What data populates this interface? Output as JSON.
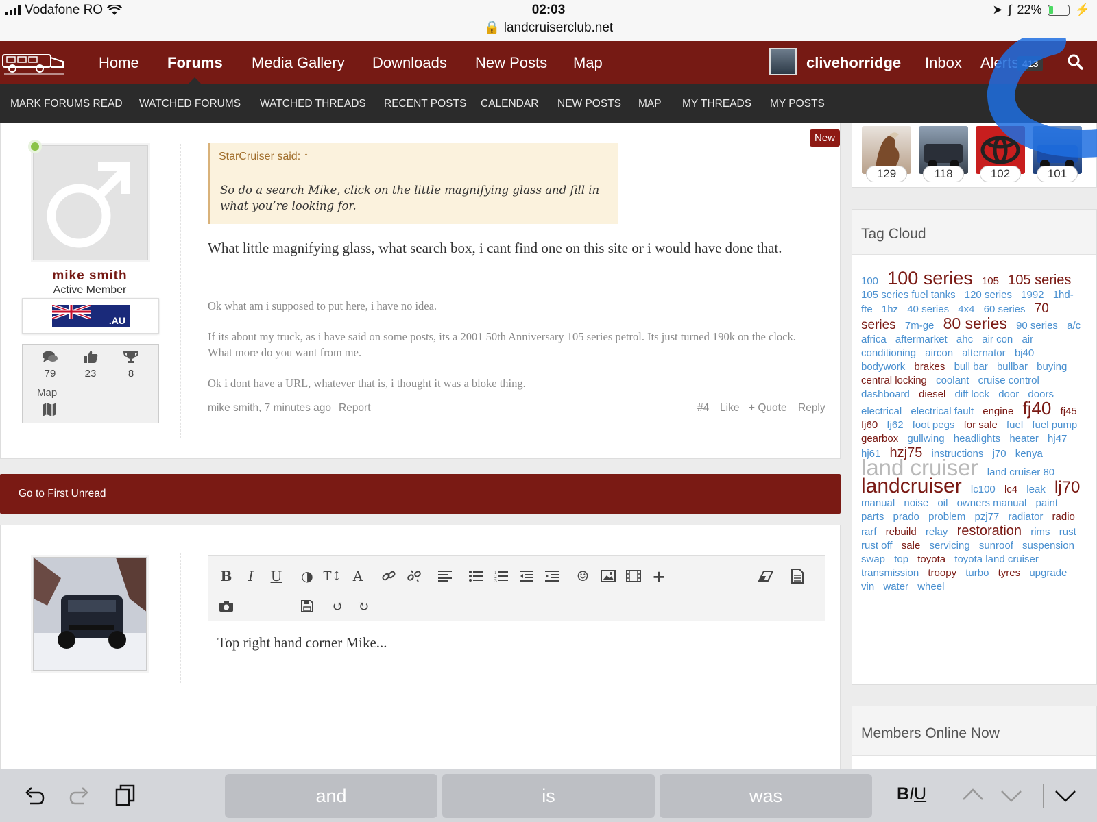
{
  "status_bar": {
    "carrier": "Vodafone RO",
    "time": "02:03",
    "url": "landcruiserclub.net",
    "battery": "22%",
    "battery_level": 0.22
  },
  "top_nav": {
    "items": [
      "Home",
      "Forums",
      "Media Gallery",
      "Downloads",
      "New Posts",
      "Map"
    ],
    "active": "Forums",
    "username": "clivehorridge",
    "inbox": "Inbox",
    "alerts": "Alerts",
    "alerts_count": "413"
  },
  "sub_nav": {
    "items": [
      "MARK FORUMS READ",
      "WATCHED FORUMS",
      "WATCHED THREADS",
      "RECENT POSTS",
      "CALENDAR",
      "NEW POSTS",
      "MAP",
      "MY THREADS",
      "MY POSTS"
    ]
  },
  "post": {
    "author": "mike smith",
    "user_title": "Active Member",
    "flag_text": ".AU",
    "stats": {
      "messages": "79",
      "likes": "23",
      "trophies": "8"
    },
    "map_label": "Map",
    "new_badge": "New",
    "quote_author": "StarCruiser said: ↑",
    "quote_text": "So do a search Mike, click on the little magnifying glass and fill in what you’re looking for.",
    "body": "What little magnifying glass, what search box, i cant find one on this site or i would have done that.",
    "signature": [
      "Ok what am i supposed to put here, i have no idea.",
      "If its about my truck, as i have said on some posts, its a 2001 50th Anniversary 105 series petrol. Its just turned 190k on the clock. What more do you want from me.",
      "Ok i dont have a URL, whatever that is, i thought it was a bloke thing."
    ],
    "meta_author_time": "mike smith, 7 minutes ago",
    "report": "Report",
    "post_number": "#4",
    "like": "Like",
    "quote": "+ Quote",
    "reply": "Reply"
  },
  "unread_bar": {
    "label": "Go to First Unread"
  },
  "reply_editor": {
    "text": "Top right hand corner Mike..."
  },
  "sidebar": {
    "thumb_counts": [
      "129",
      "118",
      "102",
      "101"
    ],
    "tag_cloud_title": "Tag Cloud",
    "tags": [
      {
        "t": "100",
        "s": 15,
        "c": "b"
      },
      {
        "t": "100 series",
        "s": 27,
        "c": "d"
      },
      {
        "t": "105",
        "s": 15,
        "c": "d"
      },
      {
        "t": "105 series",
        "s": 20,
        "c": "d"
      },
      {
        "t": "105 series fuel tanks",
        "s": 15,
        "c": "b"
      },
      {
        "t": "120 series",
        "s": 15,
        "c": "b"
      },
      {
        "t": "1992",
        "s": 15,
        "c": "b"
      },
      {
        "t": "1hd-fte",
        "s": 15,
        "c": "b"
      },
      {
        "t": "1hz",
        "s": 15,
        "c": "b"
      },
      {
        "t": "40 series",
        "s": 15,
        "c": "b"
      },
      {
        "t": "4x4",
        "s": 15,
        "c": "b"
      },
      {
        "t": "60 series",
        "s": 15,
        "c": "b"
      },
      {
        "t": "70 series",
        "s": 19,
        "c": "d"
      },
      {
        "t": "7m-ge",
        "s": 15,
        "c": "b"
      },
      {
        "t": "80 series",
        "s": 23,
        "c": "d"
      },
      {
        "t": "90 series",
        "s": 15,
        "c": "b"
      },
      {
        "t": "a/c",
        "s": 15,
        "c": "b"
      },
      {
        "t": "africa",
        "s": 15,
        "c": "b"
      },
      {
        "t": "aftermarket",
        "s": 15,
        "c": "b"
      },
      {
        "t": "ahc",
        "s": 15,
        "c": "b"
      },
      {
        "t": "air con",
        "s": 15,
        "c": "b"
      },
      {
        "t": "air conditioning",
        "s": 15,
        "c": "b"
      },
      {
        "t": "aircon",
        "s": 15,
        "c": "b"
      },
      {
        "t": "alternator",
        "s": 15,
        "c": "b"
      },
      {
        "t": "bj40",
        "s": 15,
        "c": "b"
      },
      {
        "t": "bodywork",
        "s": 15,
        "c": "b"
      },
      {
        "t": "brakes",
        "s": 15,
        "c": "d"
      },
      {
        "t": "bull bar",
        "s": 15,
        "c": "b"
      },
      {
        "t": "bullbar",
        "s": 15,
        "c": "b"
      },
      {
        "t": "buying",
        "s": 15,
        "c": "b"
      },
      {
        "t": "central locking",
        "s": 15,
        "c": "d"
      },
      {
        "t": "coolant",
        "s": 15,
        "c": "b"
      },
      {
        "t": "cruise control",
        "s": 15,
        "c": "b"
      },
      {
        "t": "dashboard",
        "s": 15,
        "c": "b"
      },
      {
        "t": "diesel",
        "s": 15,
        "c": "d"
      },
      {
        "t": "diff lock",
        "s": 15,
        "c": "b"
      },
      {
        "t": "door",
        "s": 15,
        "c": "b"
      },
      {
        "t": "doors",
        "s": 15,
        "c": "b"
      },
      {
        "t": "electrical",
        "s": 15,
        "c": "b"
      },
      {
        "t": "electrical fault",
        "s": 15,
        "c": "b"
      },
      {
        "t": "engine",
        "s": 15,
        "c": "d"
      },
      {
        "t": "fj40",
        "s": 26,
        "c": "d"
      },
      {
        "t": "fj45",
        "s": 15,
        "c": "d"
      },
      {
        "t": "fj60",
        "s": 15,
        "c": "d"
      },
      {
        "t": "fj62",
        "s": 15,
        "c": "b"
      },
      {
        "t": "foot pegs",
        "s": 15,
        "c": "b"
      },
      {
        "t": "for sale",
        "s": 15,
        "c": "d"
      },
      {
        "t": "fuel",
        "s": 15,
        "c": "b"
      },
      {
        "t": "fuel pump",
        "s": 15,
        "c": "b"
      },
      {
        "t": "gearbox",
        "s": 15,
        "c": "d"
      },
      {
        "t": "gullwing",
        "s": 15,
        "c": "b"
      },
      {
        "t": "headlights",
        "s": 15,
        "c": "b"
      },
      {
        "t": "heater",
        "s": 15,
        "c": "b"
      },
      {
        "t": "hj47",
        "s": 15,
        "c": "b"
      },
      {
        "t": "hj61",
        "s": 15,
        "c": "b"
      },
      {
        "t": "hzj75",
        "s": 20,
        "c": "d"
      },
      {
        "t": "instructions",
        "s": 15,
        "c": "b"
      },
      {
        "t": "j70",
        "s": 15,
        "c": "b"
      },
      {
        "t": "kenya",
        "s": 15,
        "c": "b"
      },
      {
        "t": "land cruiser",
        "s": 33,
        "c": "l"
      },
      {
        "t": "land cruiser 80",
        "s": 15,
        "c": "b"
      },
      {
        "t": "landcruiser",
        "s": 30,
        "c": "d"
      },
      {
        "t": "lc100",
        "s": 15,
        "c": "b"
      },
      {
        "t": "lc4",
        "s": 15,
        "c": "d"
      },
      {
        "t": "leak",
        "s": 15,
        "c": "b"
      },
      {
        "t": "lj70",
        "s": 24,
        "c": "d"
      },
      {
        "t": "manual",
        "s": 15,
        "c": "b"
      },
      {
        "t": "noise",
        "s": 15,
        "c": "b"
      },
      {
        "t": "oil",
        "s": 15,
        "c": "b"
      },
      {
        "t": "owners manual",
        "s": 15,
        "c": "b"
      },
      {
        "t": "paint",
        "s": 15,
        "c": "b"
      },
      {
        "t": "parts",
        "s": 15,
        "c": "b"
      },
      {
        "t": "prado",
        "s": 15,
        "c": "b"
      },
      {
        "t": "problem",
        "s": 15,
        "c": "b"
      },
      {
        "t": "pzj77",
        "s": 15,
        "c": "b"
      },
      {
        "t": "radiator",
        "s": 15,
        "c": "b"
      },
      {
        "t": "radio",
        "s": 15,
        "c": "d"
      },
      {
        "t": "rarf",
        "s": 15,
        "c": "b"
      },
      {
        "t": "rebuild",
        "s": 15,
        "c": "d"
      },
      {
        "t": "relay",
        "s": 15,
        "c": "b"
      },
      {
        "t": "restoration",
        "s": 20,
        "c": "d"
      },
      {
        "t": "rims",
        "s": 15,
        "c": "b"
      },
      {
        "t": "rust",
        "s": 15,
        "c": "b"
      },
      {
        "t": "rust off",
        "s": 15,
        "c": "b"
      },
      {
        "t": "sale",
        "s": 15,
        "c": "d"
      },
      {
        "t": "servicing",
        "s": 15,
        "c": "b"
      },
      {
        "t": "sunroof",
        "s": 15,
        "c": "b"
      },
      {
        "t": "suspension",
        "s": 15,
        "c": "b"
      },
      {
        "t": "swap",
        "s": 15,
        "c": "b"
      },
      {
        "t": "top",
        "s": 15,
        "c": "b"
      },
      {
        "t": "toyota",
        "s": 15,
        "c": "d"
      },
      {
        "t": "toyota land cruiser",
        "s": 15,
        "c": "b"
      },
      {
        "t": "transmission",
        "s": 15,
        "c": "b"
      },
      {
        "t": "troopy",
        "s": 15,
        "c": "d"
      },
      {
        "t": "turbo",
        "s": 15,
        "c": "b"
      },
      {
        "t": "tyres",
        "s": 15,
        "c": "d"
      },
      {
        "t": "upgrade",
        "s": 15,
        "c": "b"
      },
      {
        "t": "vin",
        "s": 15,
        "c": "b"
      },
      {
        "t": "water",
        "s": 15,
        "c": "b"
      },
      {
        "t": "wheel",
        "s": 15,
        "c": "b"
      }
    ],
    "members_title": "Members Online Now"
  },
  "keyboard_bar": {
    "suggestions": [
      "and",
      "is",
      "was"
    ],
    "format_label": "BIU"
  },
  "colors": {
    "brand": "#761a14",
    "subnav": "#2b2b2b",
    "tag_link": "#4a90d0",
    "tag_dark": "#7a1a14"
  }
}
